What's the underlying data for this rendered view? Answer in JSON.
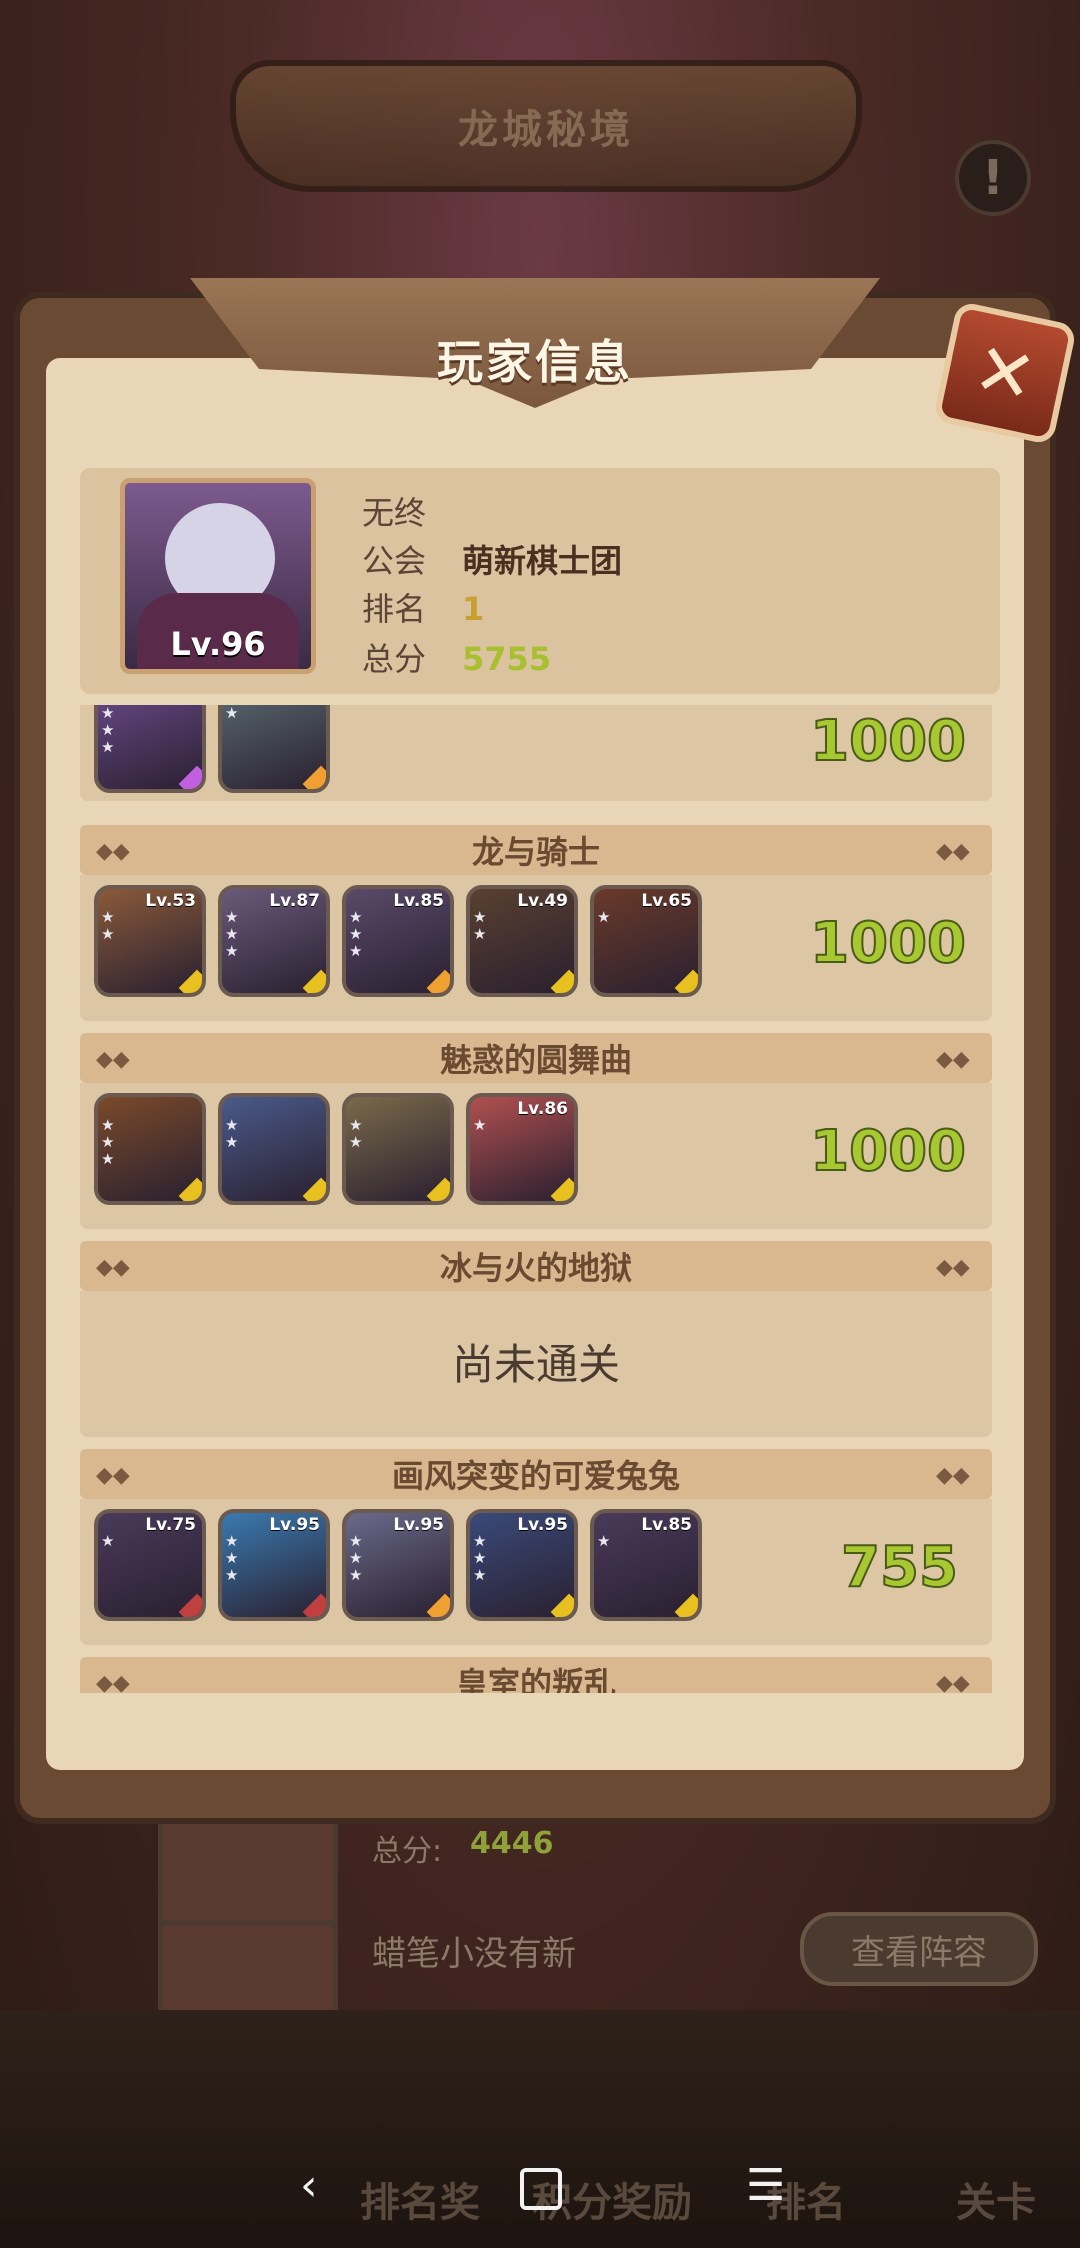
{
  "background": {
    "banner_title": "龙城秘境",
    "list_score_label": "总分:",
    "list_score_value": "4446",
    "list_player_name": "蜡笔小没有新",
    "view_lineup_button": "查看阵容",
    "tabs": [
      "排名奖",
      "积分奖励",
      "排名",
      "关卡"
    ]
  },
  "dialog": {
    "title": "玩家信息",
    "close_symbol": "✕"
  },
  "player": {
    "name": "无终",
    "level_label": "Lv.96",
    "guild_label": "公会",
    "guild_value": "萌新棋士团",
    "rank_label": "排名",
    "rank_value": "1",
    "score_label": "总分",
    "score_value": "5755"
  },
  "stages": [
    {
      "title": "",
      "score": "1000",
      "heroes": [
        {
          "level": "",
          "color": "#6a4a8a",
          "rarity": "#c060e0"
        },
        {
          "level": "",
          "color": "#5a6a70",
          "rarity": "#f0a030"
        }
      ]
    },
    {
      "title": "龙与骑士",
      "score": "1000",
      "heroes": [
        {
          "level": "Lv.53",
          "color": "#8a5a3a",
          "rarity": "#e8c020"
        },
        {
          "level": "Lv.87",
          "color": "#6a5a7a",
          "rarity": "#e8c020"
        },
        {
          "level": "Lv.85",
          "color": "#5a4a6a",
          "rarity": "#f0a030"
        },
        {
          "level": "Lv.49",
          "color": "#5a4030",
          "rarity": "#e8c020"
        },
        {
          "level": "Lv.65",
          "color": "#6a3a2a",
          "rarity": "#e8c020"
        }
      ]
    },
    {
      "title": "魅惑的圆舞曲",
      "score": "1000",
      "heroes": [
        {
          "level": "",
          "color": "#7a4a2a",
          "rarity": "#e8c020"
        },
        {
          "level": "",
          "color": "#4a5a8a",
          "rarity": "#e8c020"
        },
        {
          "level": "",
          "color": "#7a6a4a",
          "rarity": "#e8c020"
        },
        {
          "level": "Lv.86",
          "color": "#b05050",
          "rarity": "#e8c020"
        }
      ]
    },
    {
      "title": "冰与火的地狱",
      "status": "尚未通关"
    },
    {
      "title": "画风突变的可爱兔兔",
      "score": "755",
      "heroes": [
        {
          "level": "Lv.75",
          "color": "#4a3a5a",
          "rarity": "#c04040"
        },
        {
          "level": "Lv.95",
          "color": "#3a7ab0",
          "rarity": "#c04040"
        },
        {
          "level": "Lv.95",
          "color": "#6a6a8a",
          "rarity": "#f0a030"
        },
        {
          "level": "Lv.95",
          "color": "#3a4a7a",
          "rarity": "#e8c020"
        },
        {
          "level": "Lv.85",
          "color": "#4a3a5a",
          "rarity": "#e8c020"
        }
      ]
    },
    {
      "title": "皇室的叛乱"
    }
  ]
}
